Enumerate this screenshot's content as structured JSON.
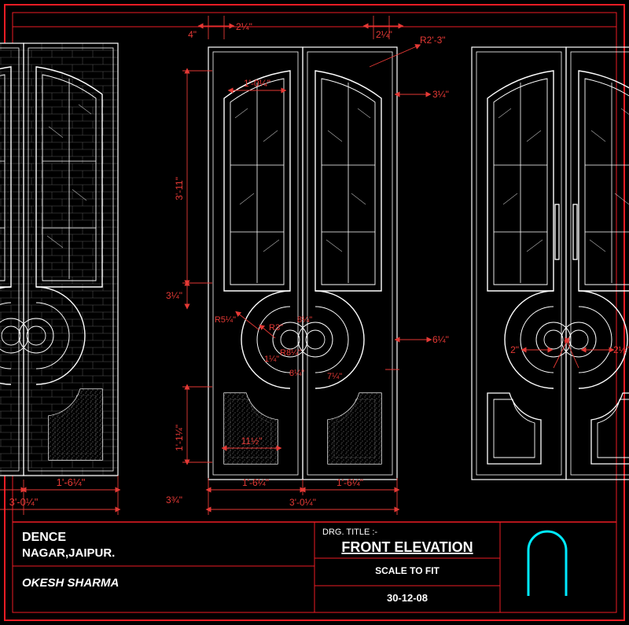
{
  "drawing": {
    "title_block": {
      "title_label": "DRG. TITLE :-",
      "title_value": "FRONT ELEVATION",
      "scale": "SCALE TO FIT",
      "date": "30-12-08"
    },
    "project": {
      "name_line1": "DENCE",
      "location": "NAGAR,JAIPUR.",
      "author": "OKESH SHARMA"
    },
    "dimensions": {
      "top_left": "4\"",
      "top_left_frac": "2¼\"",
      "top_right_frac": "2¼\"",
      "radius_arc": "R2'-3\"",
      "right_top_small": "3¼\"",
      "upper_panel_width": "1'-0¼\"",
      "upper_panel_height": "3'-11\"",
      "mid_gap": "3¼\"",
      "circle_r1": "R5¼\"",
      "circle_r2": "R3\"",
      "circle_small1": "8¼\"",
      "circle_small2": "1¼\"",
      "circle_small3": "R8¼\"",
      "circle_small4": "8¼\"",
      "right_mid_small": "6¼\"",
      "right_mid_small2": "7¼\"",
      "lower_panel_height": "1'-1¼\"",
      "lower_dim": "11½\"",
      "leaf_width_left": "1'-6¼\"",
      "leaf_width_right": "1'-6¼\"",
      "total_width": "3'-0¼\"",
      "bottom_edge": "3¾\"",
      "right_2in": "2\"",
      "right_2half": "2½\""
    },
    "colors": {
      "frame_red": "#ed1c24",
      "dim_red": "#e53935",
      "linework_white": "#ffffff",
      "text_white": "#ffffff",
      "cyan": "#00eaff"
    }
  }
}
